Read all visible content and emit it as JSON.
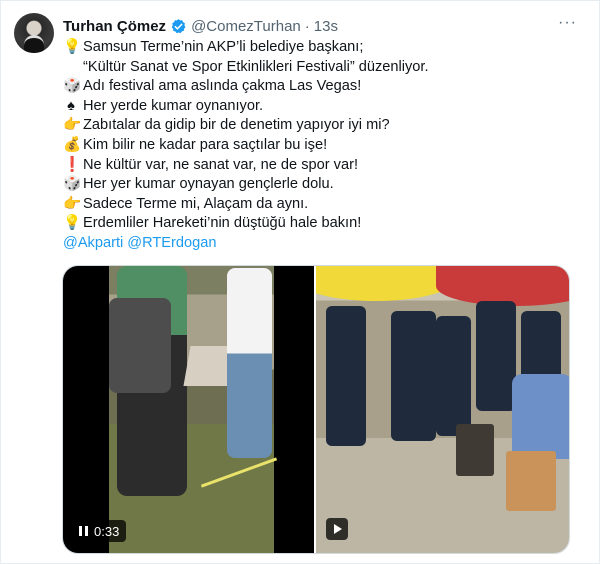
{
  "author": {
    "name": "Turhan Çömez",
    "handle": "@ComezTurhan",
    "separator": "·",
    "time": "13s"
  },
  "lines": [
    {
      "icon": "💡",
      "text": "Samsun Terme’nin AKP’li belediye başkanı;"
    },
    {
      "icon": "",
      "text": "“Kültür Sanat ve Spor Etkinlikleri Festivali” düzenliyor."
    },
    {
      "icon": "🎲",
      "text": "Adı festival ama aslında çakma Las Vegas!"
    },
    {
      "icon": "♠",
      "text": "Her yerde kumar oynanıyor."
    },
    {
      "icon": "👉",
      "text": "Zabıtalar da gidip bir de denetim yapıyor iyi mi?"
    },
    {
      "icon": "💰",
      "text": "Kim bilir ne kadar para saçtılar bu işe!"
    },
    {
      "icon": "❗",
      "text": "Ne kültür var, ne sanat var, ne de spor var!"
    },
    {
      "icon": "🎲",
      "text": "Her yer kumar oynayan gençlerle dolu."
    },
    {
      "icon": "👉",
      "text": "Sadece Terme mi, Alaçam da aynı."
    },
    {
      "icon": "💡",
      "text": "Erdemliler Hareketi’nin düştüğü hale bakın!"
    }
  ],
  "mentions": [
    "@Akparti",
    "@RTErdogan"
  ],
  "media": {
    "video1_duration": "0:33"
  },
  "icons": {
    "verified": "verified-badge-icon",
    "more": "more-options-icon",
    "pause": "pause-icon",
    "play": "play-icon"
  },
  "colors": {
    "link": "#1d9bf0",
    "verified": "#1d9bf0",
    "secondary_text": "#536471"
  }
}
